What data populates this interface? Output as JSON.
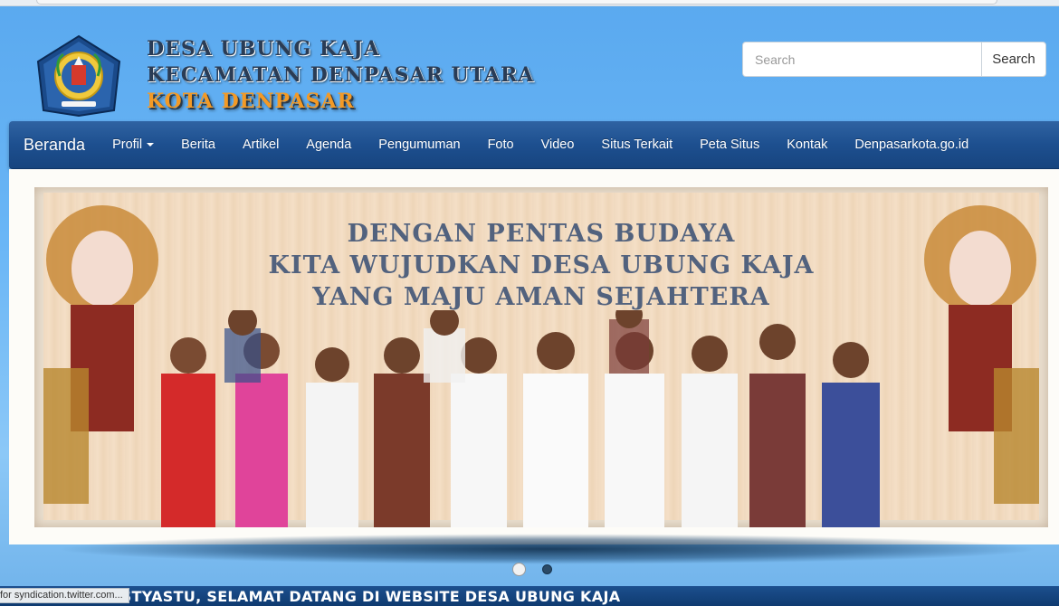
{
  "header": {
    "title_line1": "DESA UBUNG KAJA",
    "title_line2": "KECAMATAN DENPASAR UTARA",
    "title_line3": "KOTA DENPASAR",
    "logo_icon": "bali-government-crest-icon"
  },
  "search": {
    "placeholder": "Search",
    "button_label": "Search"
  },
  "nav": {
    "brand": "Beranda",
    "items": [
      {
        "label": "Profil",
        "dropdown": true
      },
      {
        "label": "Berita"
      },
      {
        "label": "Artikel"
      },
      {
        "label": "Agenda"
      },
      {
        "label": "Pengumuman"
      },
      {
        "label": "Foto"
      },
      {
        "label": "Video"
      },
      {
        "label": "Situs Terkait"
      },
      {
        "label": "Peta Situs"
      },
      {
        "label": "Kontak"
      },
      {
        "label": "Denpasarkota.go.id"
      }
    ]
  },
  "slider": {
    "banner_lines": [
      "DENGAN PENTAS BUDAYA",
      "KITA WUJUDKAN DESA UBUNG KAJA",
      "YANG MAJU AMAN SEJAHTERA"
    ],
    "slide_count": 2,
    "active_index": 0
  },
  "marquee": {
    "text": "OM SWASTYASTU, SELAMAT DATANG DI WEBSITE DESA UBUNG KAJA"
  },
  "status": {
    "text": "for syndication.twitter.com..."
  },
  "colors": {
    "nav_bg": "#1d4f8f",
    "page_bg": "#6ab6f6",
    "title_dark": "#2a3c55",
    "title_orange": "#f39a26"
  }
}
